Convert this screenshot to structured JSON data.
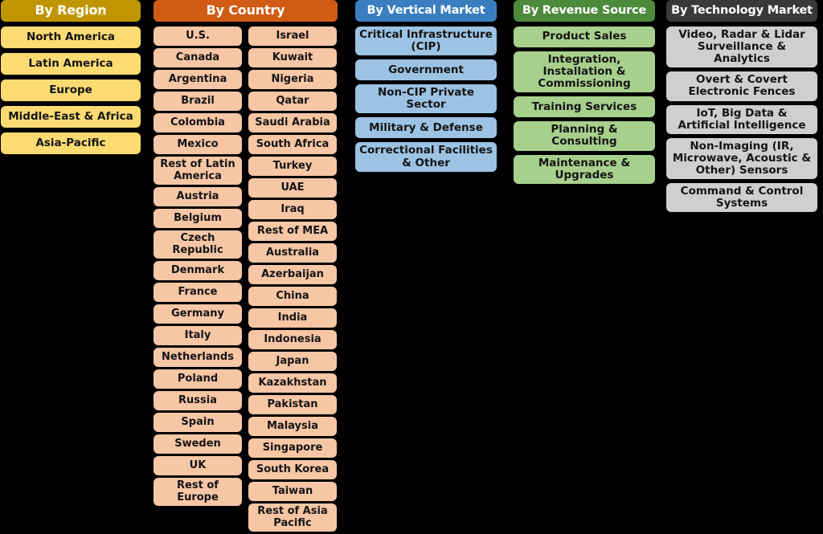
{
  "columns": [
    {
      "id": "region",
      "header": "By Region",
      "header_color": "#C09600",
      "item_color": "#FCDC72",
      "layout": "single",
      "items": [
        "North America",
        "Latin America",
        "Europe",
        "Middle-East & Africa",
        "Asia-Pacific"
      ]
    },
    {
      "id": "country",
      "header": "By Country",
      "header_color": "#CF5B15",
      "item_color": "#F7C6A5",
      "layout": "double",
      "items_left": [
        "U.S.",
        "Canada",
        "Argentina",
        "Brazil",
        "Colombia",
        "Mexico",
        "Rest of Latin America",
        "Austria",
        "Belgium",
        "Czech Republic",
        "Denmark",
        "France",
        "Germany",
        "Italy",
        "Netherlands",
        "Poland",
        "Russia",
        "Spain",
        "Sweden",
        "UK",
        "Rest of Europe"
      ],
      "items_right": [
        "Israel",
        "Kuwait",
        "Nigeria",
        "Qatar",
        "Saudi Arabia",
        "South Africa",
        "Turkey",
        "UAE",
        "Iraq",
        "Rest of MEA",
        "Australia",
        "Azerbaijan",
        "China",
        "India",
        "Indonesia",
        "Japan",
        "Kazakhstan",
        "Pakistan",
        "Malaysia",
        "Singapore",
        "South Korea",
        "Taiwan",
        "Rest of Asia Pacific"
      ]
    },
    {
      "id": "vertical",
      "header": "By Vertical Market",
      "header_color": "#3A7EBF",
      "item_color": "#9CC3E4",
      "layout": "single",
      "items": [
        "Critical Infrastructure (CIP)",
        "Government",
        "Non-CIP Private Sector",
        "Military & Defense",
        "Correctional Facilities & Other"
      ]
    },
    {
      "id": "revenue",
      "header": "By  Revenue Source",
      "header_color": "#4E8A3C",
      "item_color": "#A8D08D",
      "layout": "single",
      "items": [
        "Product Sales",
        "Integration, Installation & Commissioning",
        "Training Services",
        "Planning & Consulting",
        "Maintenance & Upgrades"
      ]
    },
    {
      "id": "technology",
      "header": "By Technology Market",
      "header_color": "#3B3838",
      "item_color": "#D0CECE",
      "layout": "single",
      "items": [
        "Video, Radar & Lidar Surveillance & Analytics",
        "Overt & Covert Electronic Fences",
        "IoT, Big Data & Artificial Intelligence",
        "Non-Imaging (IR, Microwave, Acoustic & Other) Sensors",
        "Command & Control Systems"
      ]
    }
  ]
}
